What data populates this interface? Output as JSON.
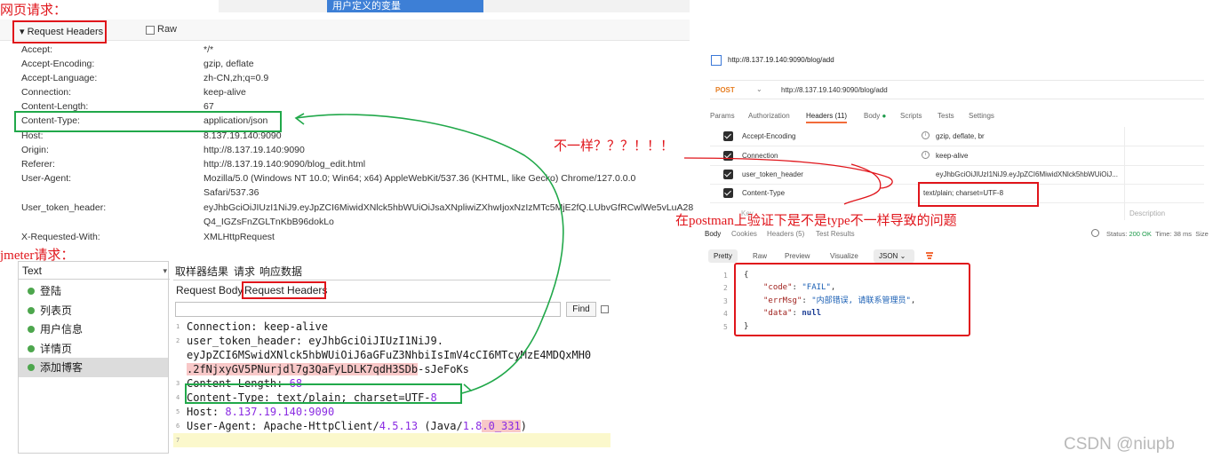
{
  "top_strip": {
    "tab_label": "用户定义的变量"
  },
  "labels": {
    "web_request": "网页请求：",
    "jmeter_request": "jmeter请求：",
    "note_different": "不一样？？？！！！",
    "note_postman": "在postman上验证下是不是type不一样导致的问题"
  },
  "web_panel": {
    "title": "▾ Request Headers",
    "raw_label": "Raw",
    "rows": [
      {
        "key": "Accept:",
        "value": "*/*"
      },
      {
        "key": "Accept-Encoding:",
        "value": "gzip, deflate"
      },
      {
        "key": "Accept-Language:",
        "value": "zh-CN,zh;q=0.9"
      },
      {
        "key": "Connection:",
        "value": "keep-alive"
      },
      {
        "key": "Content-Length:",
        "value": "67"
      },
      {
        "key": "Content-Type:",
        "value": "application/json"
      },
      {
        "key": "Host:",
        "value": "8.137.19.140:9090"
      },
      {
        "key": "Origin:",
        "value": "http://8.137.19.140:9090"
      },
      {
        "key": "Referer:",
        "value": "http://8.137.19.140:9090/blog_edit.html"
      },
      {
        "key": "User-Agent:",
        "value": "Mozilla/5.0 (Windows NT 10.0; Win64; x64) AppleWebKit/537.36 (KHTML, like Gecko) Chrome/127.0.0.0",
        "value2": "Safari/537.36"
      },
      {
        "key": "User_token_header:",
        "value": "eyJhbGciOiJIUzI1NiJ9.eyJpZCI6MiwidXNlck5hbWUiOiJsaXNpliwiZXhwIjoxNzIzMTc5MjE2fQ.LUbvGfRCwlWe5vLuA28",
        "value2": "Q4_IGZsFnZGLTnKbB96dokLo"
      },
      {
        "key": "X-Requested-With:",
        "value": "XMLHttpRequest"
      }
    ]
  },
  "jmeter": {
    "combo_value": "Text",
    "tree": [
      "登陆",
      "列表页",
      "用户信息",
      "详情页",
      "添加博客"
    ],
    "tabs": [
      "取样器结果",
      "请求",
      "响应数据"
    ],
    "subtabs": [
      "Request Body",
      "Request Headers"
    ],
    "find_label": "Find",
    "code": {
      "l1": "Connection: keep-alive",
      "l2": "user_token_header: eyJhbGciOiJIUzI1NiJ9.",
      "l2b": "eyJpZCI6MSwidXNlck5hbWUiOiJ6aGFuZ3NhbiIsImV4cCI6MTcyMzE4MDQxMH0",
      "l2c_hl": ".2fNjxyGV5PNurjdl7g3QaFyLDLK7qdH3SDb",
      "l2c_tail": "-sJeFoKs",
      "l3_key": "Content-Length: ",
      "l3_val": "68",
      "l4_key": "Content-Type: text/plain; charset=UTF-",
      "l4_val": "8",
      "l5_key": "Host: ",
      "l5_val": "8.137.19.140:9090",
      "l6_a": "User-Agent: Apache-HttpClient/",
      "l6_b": "4.5.13",
      "l6_c": " (Java/",
      "l6_d": "1.8",
      "l6_e": ".0_331",
      "l6_f": ")",
      "line_numbers": [
        "1",
        "2",
        "3",
        "4",
        "5",
        "6",
        "7"
      ]
    }
  },
  "postman": {
    "title_url": "http://8.137.19.140:9090/blog/add",
    "method": "POST",
    "url": "http://8.137.19.140:9090/blog/add",
    "tabs": [
      "Params",
      "Authorization",
      "Headers (11)",
      "Body",
      "Scripts",
      "Tests",
      "Settings"
    ],
    "rows": [
      {
        "key": "Accept-Encoding",
        "info": "i",
        "value": "gzip, deflate, br"
      },
      {
        "key": "Connection",
        "info": "i",
        "value": "keep-alive"
      },
      {
        "key": "user_token_header",
        "info": "",
        "value": "eyJhbGciOiJIUzI1NiJ9.eyJpZCI6MiwidXNlck5hbWUiOiJ..."
      },
      {
        "key": "Content-Type",
        "info": "",
        "value": "text/plain; charset=UTF-8"
      }
    ],
    "key_ghost": "Key",
    "desc_ghost": "Description",
    "resp_tabs": [
      "Body",
      "Cookies",
      "Headers (5)",
      "Test Results"
    ],
    "status_label": "Status:",
    "status_value": "200 OK",
    "time_label": "Time: 38 ms",
    "size_label": "Size",
    "view_buttons": [
      "Pretty",
      "Raw",
      "Preview",
      "Visualize"
    ],
    "json_label": "JSON",
    "json": {
      "l1": "{",
      "l2_key": "\"code\"",
      "l2_val": "\"FAIL\"",
      "l3_key": "\"errMsg\"",
      "l3_val": "\"内部错误, 请联系管理员\"",
      "l4_key": "\"data\"",
      "l4_val": "null",
      "l5": "}"
    },
    "line_numbers": [
      "1",
      "2",
      "3",
      "4",
      "5"
    ]
  },
  "watermark": "CSDN @niupb",
  "colors": {
    "annotation_red": "#e0151b",
    "annotation_green": "#21a84a",
    "postman_orange": "#f26b3a"
  }
}
